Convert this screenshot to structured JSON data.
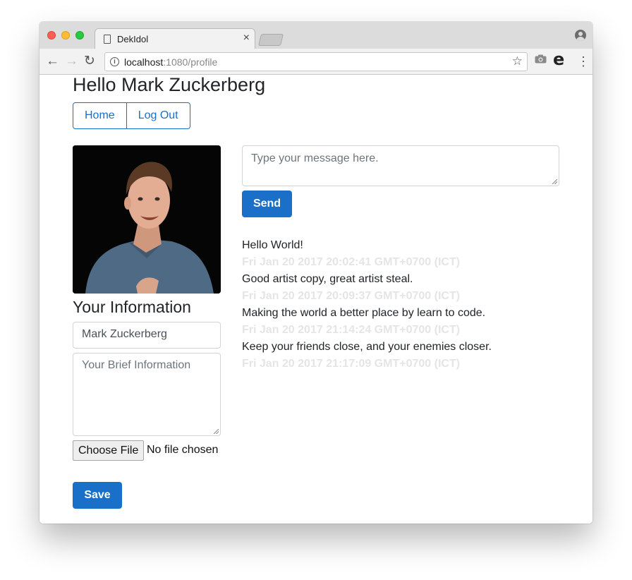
{
  "browser": {
    "tab_title": "DekIdol",
    "tab_close": "×",
    "url_host": "localhost",
    "url_path": ":1080/profile",
    "icons": [
      "back-arrow-icon",
      "forward-arrow-icon",
      "reload-icon",
      "info-icon",
      "star-icon",
      "camera-icon",
      "extension-e-icon",
      "menu-dots-icon",
      "profile-icon"
    ]
  },
  "header": {
    "greeting": "Hello Mark Zuckerberg"
  },
  "nav": {
    "home_label": "Home",
    "logout_label": "Log Out"
  },
  "sidebar": {
    "section_title": "Your Information",
    "name_value": "Mark Zuckerberg",
    "brief_placeholder": "Your Brief Information",
    "file_button_label": "Choose File",
    "file_status": "No file chosen",
    "save_label": "Save"
  },
  "composer": {
    "placeholder": "Type your message here.",
    "send_label": "Send"
  },
  "posts": [
    {
      "text": "Hello World!",
      "time": "Fri Jan 20 2017 20:02:41 GMT+0700 (ICT)"
    },
    {
      "text": "Good artist copy, great artist steal.",
      "time": "Fri Jan 20 2017 20:09:37 GMT+0700 (ICT)"
    },
    {
      "text": "Making the world a better place by learn to code.",
      "time": "Fri Jan 20 2017 21:14:24 GMT+0700 (ICT)"
    },
    {
      "text": "Keep your friends close, and your enemies closer.",
      "time": "Fri Jan 20 2017 21:17:09 GMT+0700 (ICT)"
    }
  ],
  "colors": {
    "primary": "#1a6fc9",
    "timestamp": "#e3e5e7",
    "text": "#212529"
  }
}
